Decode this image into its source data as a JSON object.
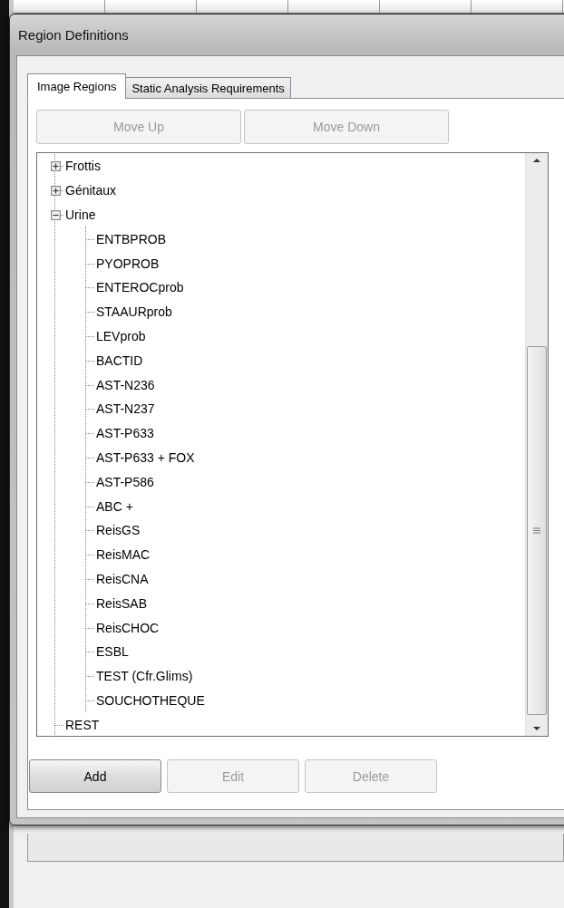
{
  "window": {
    "title": "Region Definitions"
  },
  "tabs": [
    {
      "label": "Image Regions",
      "selected": true
    },
    {
      "label": "Static Analysis Requirements",
      "selected": false
    }
  ],
  "order_buttons": [
    {
      "label": "Move Up",
      "disabled": true
    },
    {
      "label": "Move Down",
      "disabled": true
    }
  ],
  "tree": [
    {
      "label": "Frottis",
      "expanded": false
    },
    {
      "label": "Génitaux",
      "expanded": false
    },
    {
      "label": "Urine",
      "expanded": true,
      "children": [
        {
          "label": "ENTBPROB"
        },
        {
          "label": "PYOPROB"
        },
        {
          "label": "ENTEROCprob"
        },
        {
          "label": "STAAURprob"
        },
        {
          "label": "LEVprob"
        },
        {
          "label": "BACTID"
        },
        {
          "label": "AST-N236"
        },
        {
          "label": "AST-N237"
        },
        {
          "label": "AST-P633"
        },
        {
          "label": "AST-P633 + FOX"
        },
        {
          "label": "AST-P586"
        },
        {
          "label": "ABC +"
        },
        {
          "label": "ReisGS"
        },
        {
          "label": "ReisMAC"
        },
        {
          "label": "ReisCNA"
        },
        {
          "label": "ReisSAB"
        },
        {
          "label": "ReisCHOC"
        },
        {
          "label": "ESBL"
        },
        {
          "label": "TEST (Cfr.Glims)"
        },
        {
          "label": "SOUCHOTHEQUE"
        }
      ]
    },
    {
      "label": "REST"
    }
  ],
  "action_buttons": [
    {
      "label": "Add",
      "disabled": false
    },
    {
      "label": "Edit",
      "disabled": true
    },
    {
      "label": "Delete",
      "disabled": true
    }
  ]
}
